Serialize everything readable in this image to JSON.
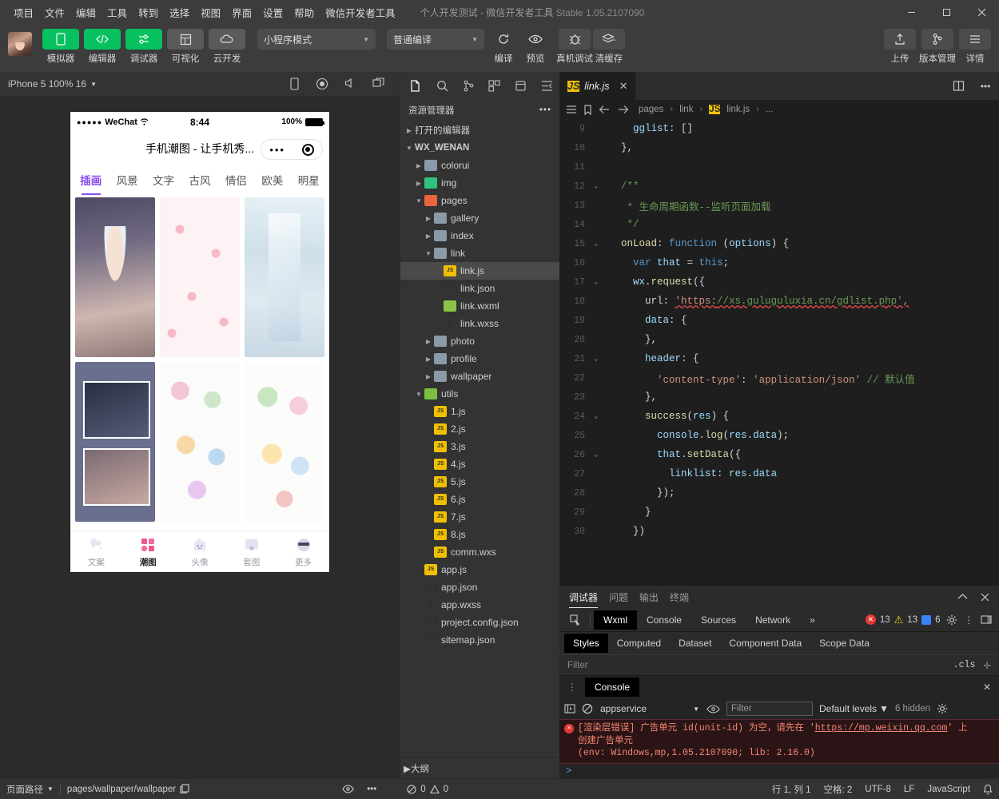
{
  "titlebar": {
    "menus": [
      "项目",
      "文件",
      "编辑",
      "工具",
      "转到",
      "选择",
      "视图",
      "界面",
      "设置",
      "帮助",
      "微信开发者工具"
    ],
    "project_title": "个人开发测试 - 微信开发者工具",
    "version": "Stable 1.05.2107090",
    "window_controls": [
      "minimize-icon",
      "maximize-icon",
      "close-icon"
    ]
  },
  "toolbar": {
    "left_buttons": [
      {
        "label": "模拟器",
        "icon": "phone-icon",
        "state": "active"
      },
      {
        "label": "编辑器",
        "icon": "code-icon",
        "state": "active"
      },
      {
        "label": "调试器",
        "icon": "debug-sliders-icon",
        "state": "active"
      },
      {
        "label": "可视化",
        "icon": "layout-icon",
        "state": "inactive"
      },
      {
        "label": "云开发",
        "icon": "cloud-icon",
        "state": "inactive"
      }
    ],
    "mode_select": "小程序模式",
    "compile_select": "普通编译",
    "actions": [
      {
        "label": "编译",
        "icon": "refresh-icon"
      },
      {
        "label": "预览",
        "icon": "eye-icon"
      },
      {
        "label": "真机调试",
        "icon": "bug-icon"
      },
      {
        "label": "清缓存",
        "icon": "layers-icon"
      }
    ],
    "right_buttons": [
      {
        "label": "上传",
        "icon": "upload-icon"
      },
      {
        "label": "版本管理",
        "icon": "git-branch-icon"
      },
      {
        "label": "详情",
        "icon": "hamburger-icon"
      }
    ]
  },
  "simulator": {
    "device_label": "iPhone 5 100% 16",
    "bar_icons": [
      "device-rotate-icon",
      "record-icon",
      "volume-icon",
      "multi-window-icon"
    ],
    "phone": {
      "carrier": "WeChat",
      "signal_dots": "●●●●●",
      "time": "8:44",
      "battery_percent": "100%",
      "nav_title": "手机潮图 - 让手机秀...",
      "capsule": [
        "more-dots-icon",
        "target-icon"
      ],
      "category_tabs": [
        "插画",
        "风景",
        "文字",
        "古风",
        "情侣",
        "欧美",
        "明星"
      ],
      "active_category": "插画",
      "tabbar": [
        {
          "label": "文案",
          "icon": "balloon-icon",
          "active": false
        },
        {
          "label": "潮图",
          "icon": "grid-squares-icon",
          "active": true
        },
        {
          "label": "头像",
          "icon": "ghost-icon",
          "active": false
        },
        {
          "label": "套图",
          "icon": "photo-stack-icon",
          "active": false
        },
        {
          "label": "更多",
          "icon": "sunglasses-face-icon",
          "active": false
        }
      ]
    }
  },
  "explorer": {
    "activity_icons": [
      "files-icon",
      "search-icon",
      "source-control-icon",
      "extensions-icon",
      "debug-icon",
      "collapse-icon"
    ],
    "title": "资源管理器",
    "menu_icon": "ellipsis-icon",
    "tree": [
      {
        "label": "打开的编辑器",
        "depth": 0,
        "type": "section",
        "arrow": "right"
      },
      {
        "label": "WX_WENAN",
        "depth": 0,
        "type": "root",
        "arrow": "down"
      },
      {
        "label": "colorui",
        "depth": 1,
        "type": "folder",
        "arrow": "right"
      },
      {
        "label": "img",
        "depth": 1,
        "type": "folder-green",
        "arrow": "right"
      },
      {
        "label": "pages",
        "depth": 1,
        "type": "folder-red",
        "arrow": "down"
      },
      {
        "label": "gallery",
        "depth": 2,
        "type": "folder",
        "arrow": "right"
      },
      {
        "label": "index",
        "depth": 2,
        "type": "folder",
        "arrow": "right"
      },
      {
        "label": "link",
        "depth": 2,
        "type": "folder-open",
        "arrow": "down"
      },
      {
        "label": "link.js",
        "depth": 3,
        "type": "js",
        "selected": true
      },
      {
        "label": "link.json",
        "depth": 3,
        "type": "json"
      },
      {
        "label": "link.wxml",
        "depth": 3,
        "type": "wxml"
      },
      {
        "label": "link.wxss",
        "depth": 3,
        "type": "wxss"
      },
      {
        "label": "photo",
        "depth": 2,
        "type": "folder",
        "arrow": "right"
      },
      {
        "label": "profile",
        "depth": 2,
        "type": "folder",
        "arrow": "right"
      },
      {
        "label": "wallpaper",
        "depth": 2,
        "type": "folder",
        "arrow": "right"
      },
      {
        "label": "utils",
        "depth": 1,
        "type": "folder-lime",
        "arrow": "down"
      },
      {
        "label": "1.js",
        "depth": 2,
        "type": "js"
      },
      {
        "label": "2.js",
        "depth": 2,
        "type": "js"
      },
      {
        "label": "3.js",
        "depth": 2,
        "type": "js"
      },
      {
        "label": "4.js",
        "depth": 2,
        "type": "js"
      },
      {
        "label": "5.js",
        "depth": 2,
        "type": "js"
      },
      {
        "label": "6.js",
        "depth": 2,
        "type": "js"
      },
      {
        "label": "7.js",
        "depth": 2,
        "type": "js"
      },
      {
        "label": "8.js",
        "depth": 2,
        "type": "js"
      },
      {
        "label": "comm.wxs",
        "depth": 2,
        "type": "js"
      },
      {
        "label": "app.js",
        "depth": 1,
        "type": "js"
      },
      {
        "label": "app.json",
        "depth": 1,
        "type": "json"
      },
      {
        "label": "app.wxss",
        "depth": 1,
        "type": "wxss"
      },
      {
        "label": "project.config.json",
        "depth": 1,
        "type": "json"
      },
      {
        "label": "sitemap.json",
        "depth": 1,
        "type": "json"
      }
    ],
    "outline_label": "大纲"
  },
  "editor": {
    "tab": {
      "name": "link.js",
      "icon": "js-icon",
      "close": "close-icon"
    },
    "tab_actions": [
      "split-editor-icon",
      "more-actions-icon"
    ],
    "breadcrumb_icons": [
      "outline-list-icon",
      "bookmark-icon",
      "back-arrow-icon",
      "forward-arrow-icon"
    ],
    "breadcrumb": [
      "pages",
      "link",
      "link.js",
      "..."
    ],
    "lines": [
      {
        "num": "9",
        "fold": "",
        "code": "    gglist: []"
      },
      {
        "num": "10",
        "fold": "",
        "code": "  },"
      },
      {
        "num": "11",
        "fold": "",
        "code": ""
      },
      {
        "num": "12",
        "fold": "v",
        "code": "  /**"
      },
      {
        "num": "13",
        "fold": "",
        "code": "   * 生命周期函数--监听页面加载"
      },
      {
        "num": "14",
        "fold": "",
        "code": "   */"
      },
      {
        "num": "15",
        "fold": "v",
        "code": "  onLoad: function (options) {"
      },
      {
        "num": "16",
        "fold": "",
        "code": "    var that = this;"
      },
      {
        "num": "17",
        "fold": "v",
        "code": "    wx.request({"
      },
      {
        "num": "18",
        "fold": "",
        "code": "      url: 'https://xs.guluguluxia.cn/gdlist.php',"
      },
      {
        "num": "19",
        "fold": "",
        "code": "      data: {"
      },
      {
        "num": "20",
        "fold": "",
        "code": "      },"
      },
      {
        "num": "21",
        "fold": "v",
        "code": "      header: {"
      },
      {
        "num": "22",
        "fold": "",
        "code": "        'content-type': 'application/json' // 默认值"
      },
      {
        "num": "23",
        "fold": "",
        "code": "      },"
      },
      {
        "num": "24",
        "fold": "v",
        "code": "      success(res) {"
      },
      {
        "num": "25",
        "fold": "",
        "code": "        console.log(res.data);"
      },
      {
        "num": "26",
        "fold": "v",
        "code": "        that.setData({"
      },
      {
        "num": "27",
        "fold": "",
        "code": "          linklist: res.data"
      },
      {
        "num": "28",
        "fold": "",
        "code": "        });"
      },
      {
        "num": "29",
        "fold": "",
        "code": "      }"
      },
      {
        "num": "30",
        "fold": "",
        "code": "    })"
      }
    ]
  },
  "debugger": {
    "panel_tabs": [
      "调试器",
      "问题",
      "输出",
      "终端"
    ],
    "active_panel_tab": "调试器",
    "panel_actions": [
      "chevron-up-icon",
      "close-icon"
    ],
    "devtools_tabs": [
      "Wxml",
      "Console",
      "Sources",
      "Network"
    ],
    "active_devtools_tab": "Wxml",
    "overflow": "»",
    "inspect_icon": "inspect-cursor-icon",
    "counts": {
      "errors": "13",
      "warnings": "13",
      "infos": "6"
    },
    "right_icons": [
      "gear-icon",
      "kebab-menu-icon",
      "dock-icon"
    ],
    "style_tabs": [
      "Styles",
      "Computed",
      "Dataset",
      "Component Data",
      "Scope Data"
    ],
    "active_style_tab": "Styles",
    "filter_placeholder": "Filter",
    "cls_label": ".cls",
    "add_icon": "plus-icon"
  },
  "console": {
    "tab": "Console",
    "kebab_icon": "kebab-menu-icon",
    "close_icon": "close-icon",
    "toolbar_icons": [
      "sidebar-toggle-icon",
      "clear-console-icon",
      "eye-icon",
      "gear-icon"
    ],
    "context": "appservice",
    "filter_placeholder": "Filter",
    "levels": "Default levels",
    "hidden": "6 hidden",
    "error": {
      "line1_prefix": "[渲染层错误] 广告单元 id(unit-id) 为空，请先在 '",
      "link": "https://mp.weixin.qq.com",
      "line1_suffix": "' 上",
      "line2": "创建广告单元",
      "line3": "(env: Windows,mp,1.05.2107090; lib: 2.16.0)"
    },
    "prompt": ">"
  },
  "statusbar": {
    "page_path_label": "页面路径",
    "page_path": "pages/wallpaper/wallpaper",
    "copy_icon": "copy-icon",
    "eye_icon": "eye-icon",
    "more_icon": "ellipsis-icon",
    "errors": "0",
    "warnings": "0",
    "cursor": "行 1, 列 1",
    "indent": "空格: 2",
    "encoding": "UTF-8",
    "eol": "LF",
    "language": "JavaScript",
    "bell_icon": "bell-icon"
  },
  "colors": {
    "accent_green": "#07c160",
    "error_red": "#e53935",
    "warning_yellow": "#f5c518",
    "phone_accent": "#8a4df0"
  }
}
